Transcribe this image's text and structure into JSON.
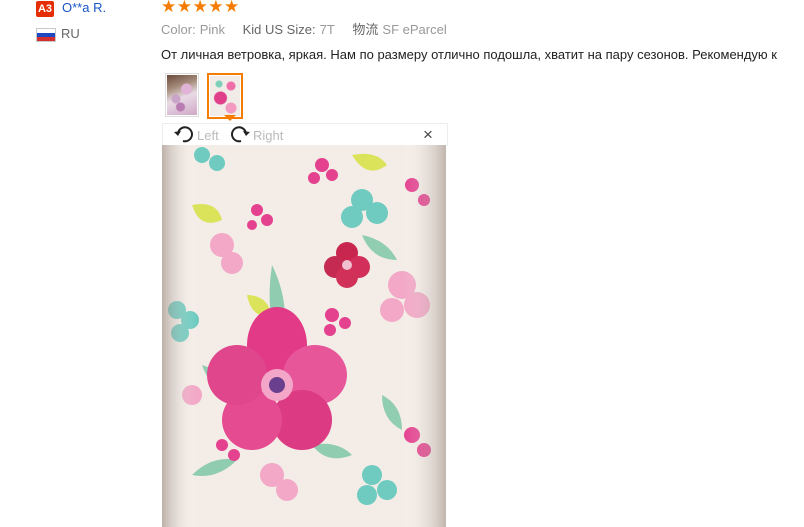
{
  "reviewer": {
    "initials": "A3",
    "name": "O**a R.",
    "country": "RU",
    "flag_colors": [
      "#ffffff",
      "#1d49c2",
      "#d32f2f"
    ]
  },
  "review": {
    "stars": "★★★★★",
    "rating": 5,
    "star_color": "#f57c00",
    "attributes": [
      {
        "label": "Color:",
        "value": "Pink"
      },
      {
        "label": "Kid US Size:",
        "value": "7T"
      },
      {
        "label": "物流",
        "value": "SF eParcel"
      }
    ],
    "text": "От личная ветровка, яркая. Нам по размеру отлично подошла, хватит на пару сезонов. Рекомендую к"
  },
  "viewer": {
    "rotate_left_label": "Left",
    "rotate_right_label": "Right",
    "close_label": "×",
    "selected_thumbnail": 2
  }
}
